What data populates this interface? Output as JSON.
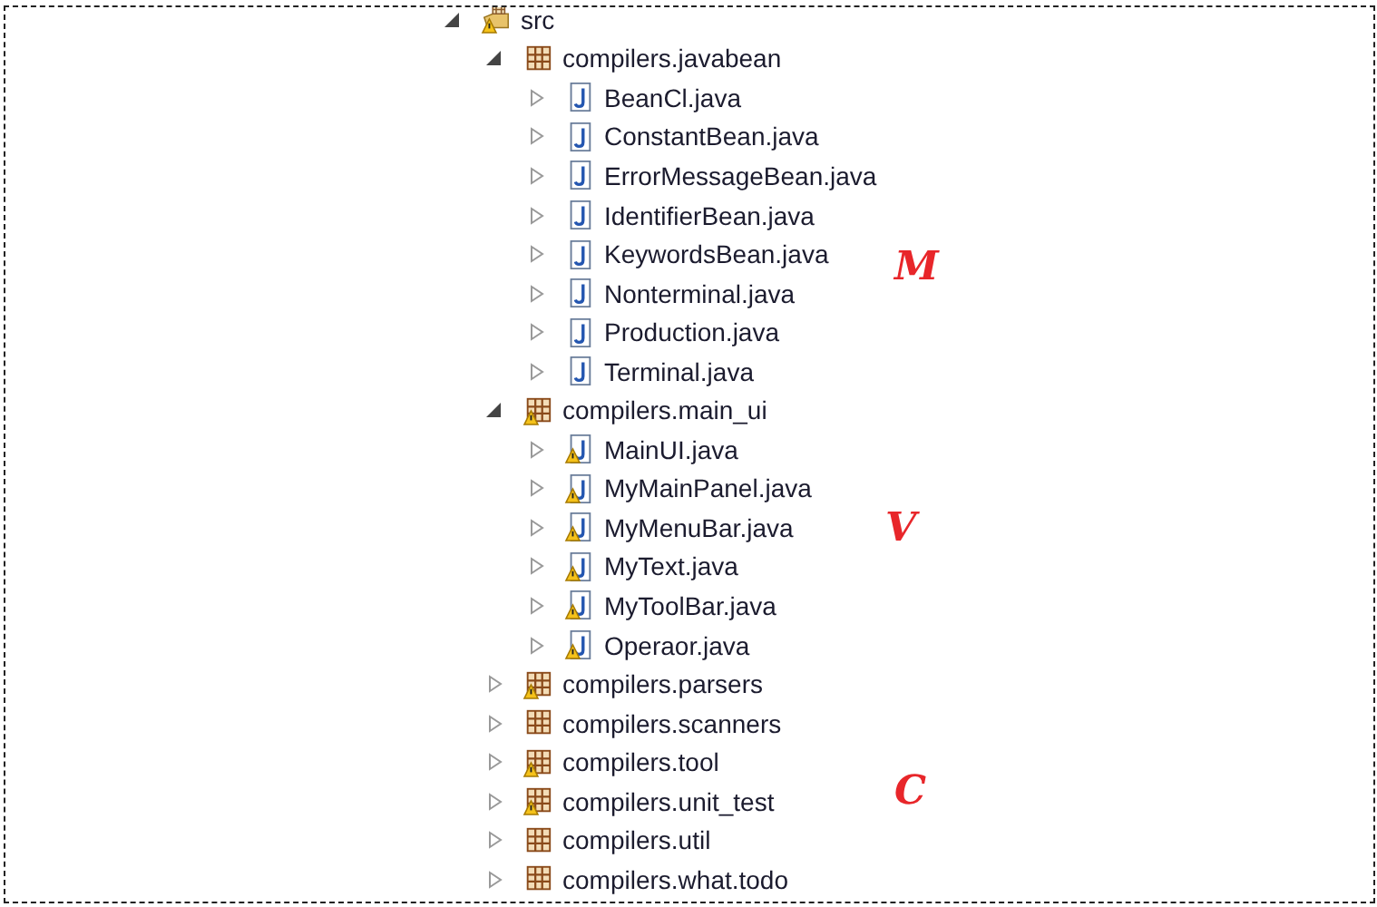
{
  "tree": [
    {
      "label": "src",
      "kind": "source-folder",
      "expanded": true,
      "warning": true,
      "children": [
        {
          "label": "compilers.javabean",
          "kind": "package",
          "expanded": true,
          "warning": false,
          "children": [
            {
              "label": "BeanCl.java",
              "kind": "java-file",
              "expanded": false,
              "warning": false
            },
            {
              "label": "ConstantBean.java",
              "kind": "java-file",
              "expanded": false,
              "warning": false
            },
            {
              "label": "ErrorMessageBean.java",
              "kind": "java-file",
              "expanded": false,
              "warning": false
            },
            {
              "label": "IdentifierBean.java",
              "kind": "java-file",
              "expanded": false,
              "warning": false
            },
            {
              "label": "KeywordsBean.java",
              "kind": "java-file",
              "expanded": false,
              "warning": false
            },
            {
              "label": "Nonterminal.java",
              "kind": "java-file",
              "expanded": false,
              "warning": false
            },
            {
              "label": "Production.java",
              "kind": "java-file",
              "expanded": false,
              "warning": false
            },
            {
              "label": "Terminal.java",
              "kind": "java-file",
              "expanded": false,
              "warning": false
            }
          ]
        },
        {
          "label": "compilers.main_ui",
          "kind": "package",
          "expanded": true,
          "warning": true,
          "children": [
            {
              "label": "MainUI.java",
              "kind": "java-file",
              "expanded": false,
              "warning": true
            },
            {
              "label": "MyMainPanel.java",
              "kind": "java-file",
              "expanded": false,
              "warning": true
            },
            {
              "label": "MyMenuBar.java",
              "kind": "java-file",
              "expanded": false,
              "warning": true
            },
            {
              "label": "MyText.java",
              "kind": "java-file",
              "expanded": false,
              "warning": true
            },
            {
              "label": "MyToolBar.java",
              "kind": "java-file",
              "expanded": false,
              "warning": true
            },
            {
              "label": "Operaor.java",
              "kind": "java-file",
              "expanded": false,
              "warning": true
            }
          ]
        },
        {
          "label": "compilers.parsers",
          "kind": "package",
          "expanded": false,
          "warning": true
        },
        {
          "label": "compilers.scanners",
          "kind": "package",
          "expanded": false,
          "warning": false
        },
        {
          "label": "compilers.tool",
          "kind": "package",
          "expanded": false,
          "warning": true
        },
        {
          "label": "compilers.unit_test",
          "kind": "package",
          "expanded": false,
          "warning": true
        },
        {
          "label": "compilers.util",
          "kind": "package",
          "expanded": false,
          "warning": false
        },
        {
          "label": "compilers.what.todo",
          "kind": "package",
          "expanded": false,
          "warning": false
        }
      ]
    }
  ],
  "annotations": [
    "M",
    "V",
    "C"
  ]
}
